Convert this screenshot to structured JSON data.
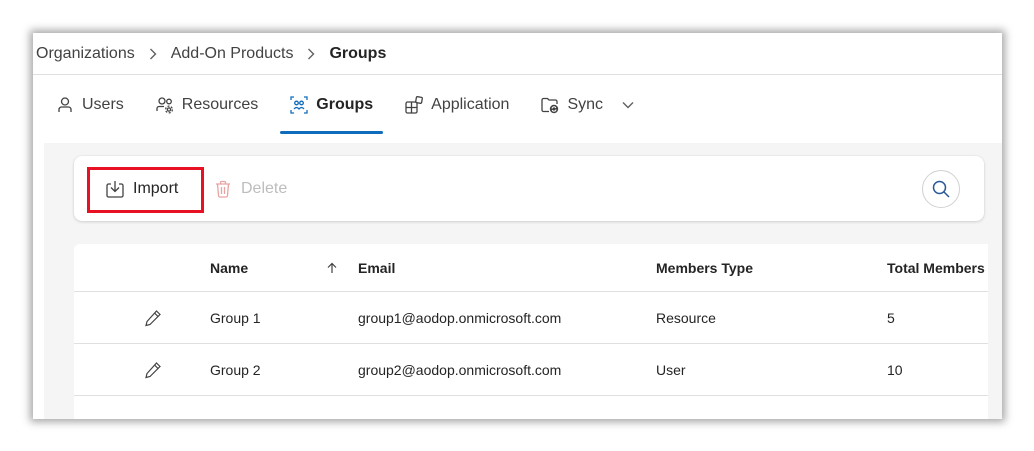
{
  "breadcrumb": {
    "items": [
      "Organizations",
      "Add-On Products",
      "Groups"
    ]
  },
  "tabs": [
    {
      "label": "Users",
      "icon": "person-icon"
    },
    {
      "label": "Resources",
      "icon": "people-settings-icon"
    },
    {
      "label": "Groups",
      "icon": "group-select-icon",
      "active": true
    },
    {
      "label": "Application",
      "icon": "apps-add-icon"
    },
    {
      "label": "Sync",
      "icon": "folder-sync-icon"
    }
  ],
  "toolbar": {
    "import_label": "Import",
    "delete_label": "Delete",
    "import_icon": "import-icon",
    "delete_icon": "trash-icon",
    "search_icon": "search-icon"
  },
  "table": {
    "columns": [
      "Name",
      "Email",
      "Members Type",
      "Total Members"
    ],
    "sort_icon": "arrow-up-icon",
    "rows": [
      {
        "name": "Group 1",
        "email": "group1@aodop.onmicrosoft.com",
        "members_type": "Resource",
        "total_members": "5"
      },
      {
        "name": "Group 2",
        "email": "group2@aodop.onmicrosoft.com",
        "members_type": "User",
        "total_members": "10"
      }
    ]
  },
  "colors": {
    "accent": "#0f6cbd",
    "highlight": "#e81123",
    "disabled": "#bdbdbd"
  }
}
